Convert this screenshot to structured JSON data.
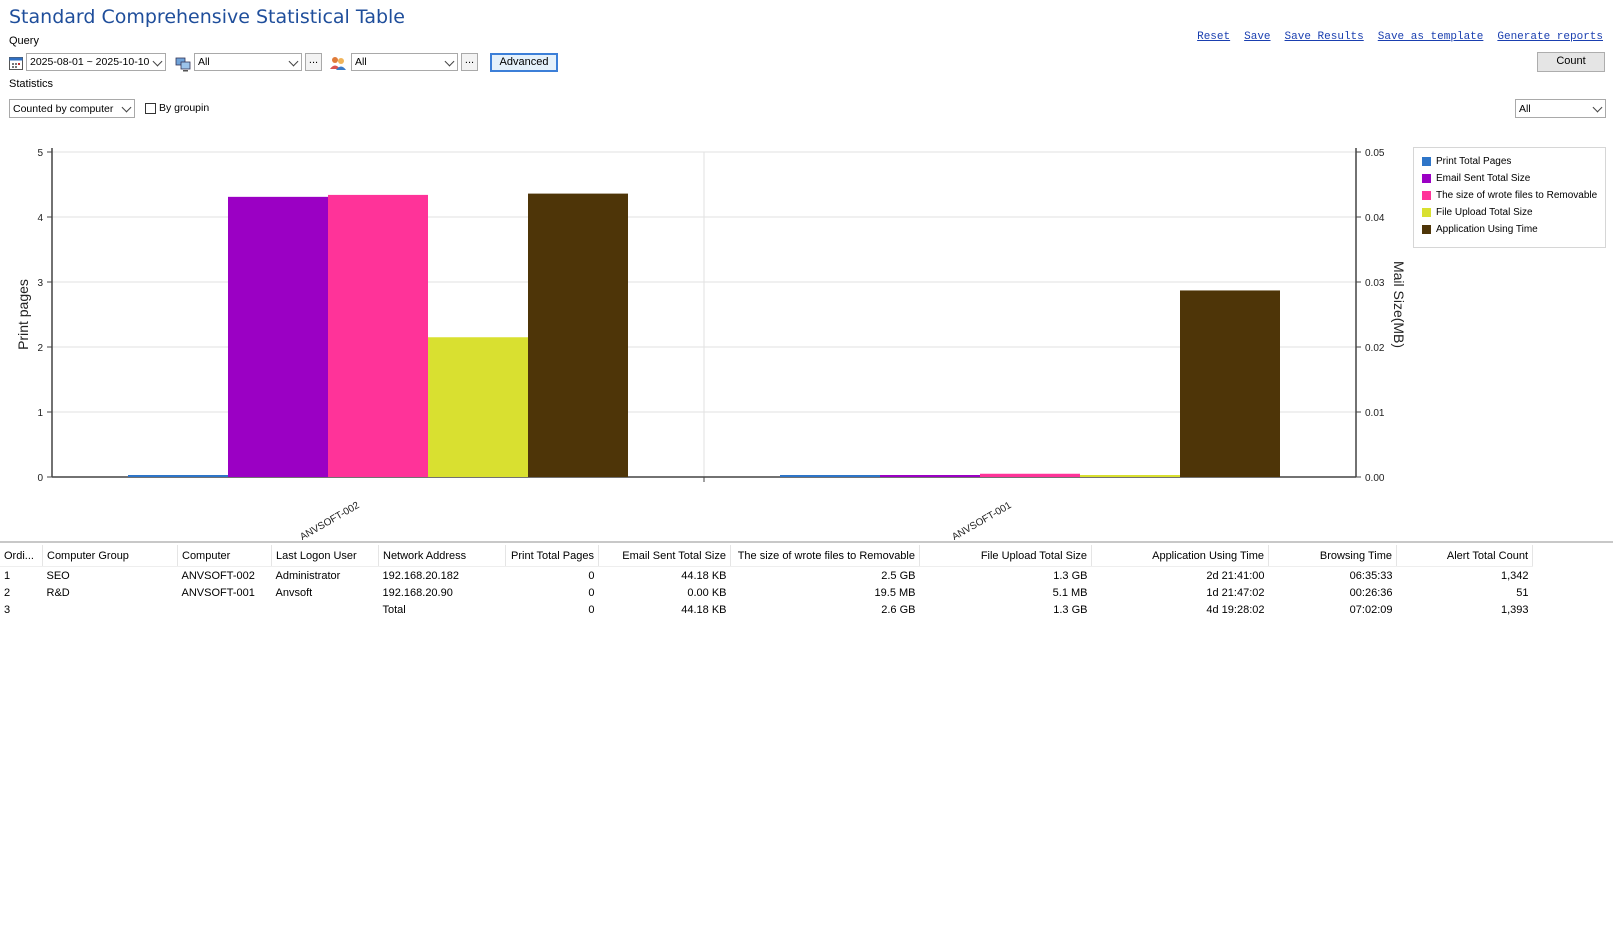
{
  "title": "Standard Comprehensive Statistical Table",
  "query": {
    "label": "Query",
    "date_range": "2025-08-01 ~ 2025-10-10",
    "computer_filter": "All",
    "user_filter": "All",
    "more_label": "...",
    "advanced_label": "Advanced"
  },
  "toolbar": {
    "links": [
      "Reset",
      "Save",
      "Save Results",
      "Save as template",
      "Generate reports"
    ],
    "count_label": "Count"
  },
  "statistics": {
    "label": "Statistics",
    "mode": "Counted by computer",
    "by_grouping_label": "By groupin",
    "by_grouping_checked": false,
    "filter": "All"
  },
  "colors": {
    "print": "#2e75c8",
    "email": "#9b00c4",
    "removable": "#ff3399",
    "upload": "#d9e030",
    "app_time": "#4e3508",
    "title": "#1f4e9b"
  },
  "chart_data": {
    "type": "bar",
    "categories": [
      "ANVSOFT-002",
      "ANVSOFT-001"
    ],
    "ylabel": "Print pages",
    "y2label": "Mail Size(MB)",
    "ylim": [
      0,
      5
    ],
    "y2lim": [
      0,
      0.05
    ],
    "yticks": [
      "0",
      "1",
      "2",
      "3",
      "4",
      "5"
    ],
    "y2ticks": [
      "0.00",
      "0.01",
      "0.02",
      "0.03",
      "0.04",
      "0.05"
    ],
    "grid": true,
    "legend_position": "top-right",
    "series": [
      {
        "name": "Print Total Pages",
        "values": [
          0,
          0
        ]
      },
      {
        "name": "Email Sent Total Size",
        "values": [
          4.31,
          0
        ]
      },
      {
        "name": "The size of wrote files to Removable",
        "values": [
          4.34,
          0.05
        ]
      },
      {
        "name": "File Upload Total Size",
        "values": [
          2.15,
          0
        ]
      },
      {
        "name": "Application Using Time",
        "values": [
          4.36,
          2.87
        ]
      }
    ]
  },
  "table": {
    "columns": [
      "Ordi...",
      "Computer Group",
      "Computer",
      "Last Logon User",
      "Network Address",
      "Print Total Pages",
      "Email Sent Total Size",
      "The size of wrote files to Removable",
      "File Upload Total Size",
      "Application Using Time",
      "Browsing Time",
      "Alert Total Count"
    ],
    "rows": [
      [
        "1",
        "SEO",
        "ANVSOFT-002",
        "Administrator",
        "192.168.20.182",
        "0",
        "44.18 KB",
        "2.5 GB",
        "1.3 GB",
        "2d 21:41:00",
        "06:35:33",
        "1,342"
      ],
      [
        "2",
        "R&D",
        "ANVSOFT-001",
        "Anvsoft",
        "192.168.20.90",
        "0",
        "0.00 KB",
        "19.5 MB",
        "5.1 MB",
        "1d 21:47:02",
        "00:26:36",
        "51"
      ],
      [
        "3",
        "",
        "",
        "",
        "Total",
        "0",
        "44.18 KB",
        "2.6 GB",
        "1.3 GB",
        "4d 19:28:02",
        "07:02:09",
        "1,393"
      ]
    ]
  }
}
